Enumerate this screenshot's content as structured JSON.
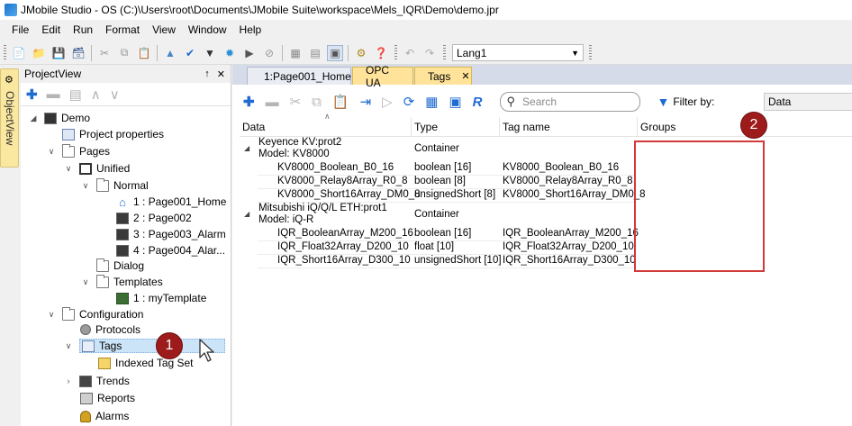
{
  "window": {
    "title": "JMobile Studio - OS (C:)\\Users\\root\\Documents\\JMobile Suite\\workspace\\Mels_IQR\\Demo\\demo.jpr"
  },
  "menu": [
    "File",
    "Edit",
    "Run",
    "Format",
    "View",
    "Window",
    "Help"
  ],
  "toolbar": {
    "language": "Lang1"
  },
  "sidebar_tab": {
    "label": "ObjectView"
  },
  "project_panel": {
    "title": "ProjectView",
    "pin": "↑",
    "close": "✕",
    "tree": [
      {
        "label": "Demo",
        "icon": "monitor-icon"
      },
      {
        "label": "Project properties",
        "icon": "properties-icon"
      },
      {
        "label": "Pages",
        "icon": "folder-icon"
      },
      {
        "label": "Unified",
        "icon": "screen-icon"
      },
      {
        "label": "Normal",
        "icon": "folder-icon"
      },
      {
        "label": "1 : Page001_Home",
        "icon": "home-icon"
      },
      {
        "label": "2 : Page002",
        "icon": "page-icon"
      },
      {
        "label": "3 : Page003_Alarm",
        "icon": "page-icon"
      },
      {
        "label": "4 : Page004_Alar...",
        "icon": "page-icon"
      },
      {
        "label": "Dialog",
        "icon": "folder-icon"
      },
      {
        "label": "Templates",
        "icon": "folder-icon"
      },
      {
        "label": "1 : myTemplate",
        "icon": "template-icon"
      },
      {
        "label": "Configuration",
        "icon": "folder-icon"
      },
      {
        "label": "Protocols",
        "icon": "protocols-icon"
      },
      {
        "label": "Tags",
        "icon": "tags-icon"
      },
      {
        "label": "Indexed Tag Set",
        "icon": "indexed-tag-icon"
      },
      {
        "label": "Trends",
        "icon": "trends-icon"
      },
      {
        "label": "Reports",
        "icon": "printer-icon"
      },
      {
        "label": "Alarms",
        "icon": "bell-icon"
      }
    ]
  },
  "badges": {
    "one": "1",
    "two": "2"
  },
  "tabs": [
    {
      "label": "1:Page001_Home"
    },
    {
      "label": "OPC UA"
    },
    {
      "label": "Tags",
      "close": "✕"
    }
  ],
  "tags_toolbar": {
    "search_placeholder": "Search",
    "filter_label": "Filter by:",
    "filter_value": "Data"
  },
  "grid": {
    "columns": [
      "Data",
      "Type",
      "Tag name",
      "Groups"
    ],
    "groups": [
      {
        "name_line1": "Keyence KV:prot2",
        "name_line2": "Model: KV8000",
        "type": "Container",
        "rows": [
          {
            "data": "KV8000_Boolean_B0_16",
            "type": "boolean [16]",
            "tag": "KV8000_Boolean_B0_16"
          },
          {
            "data": "KV8000_Relay8Array_R0_8",
            "type": "boolean [8]",
            "tag": "KV8000_Relay8Array_R0_8"
          },
          {
            "data": "KV8000_Short16Array_DM0_8",
            "type": "unsignedShort [8]",
            "tag": "KV8000_Short16Array_DM0_8"
          }
        ]
      },
      {
        "name_line1": "Mitsubishi iQ/Q/L ETH:prot1",
        "name_line2": "Model: iQ-R",
        "type": "Container",
        "rows": [
          {
            "data": "IQR_BooleanArray_M200_16",
            "type": "boolean [16]",
            "tag": "IQR_BooleanArray_M200_16"
          },
          {
            "data": "IQR_Float32Array_D200_10",
            "type": "float [10]",
            "tag": "IQR_Float32Array_D200_10"
          },
          {
            "data": "IQR_Short16Array_D300_10",
            "type": "unsignedShort [10]",
            "tag": "IQR_Short16Array_D300_10"
          }
        ]
      }
    ]
  }
}
